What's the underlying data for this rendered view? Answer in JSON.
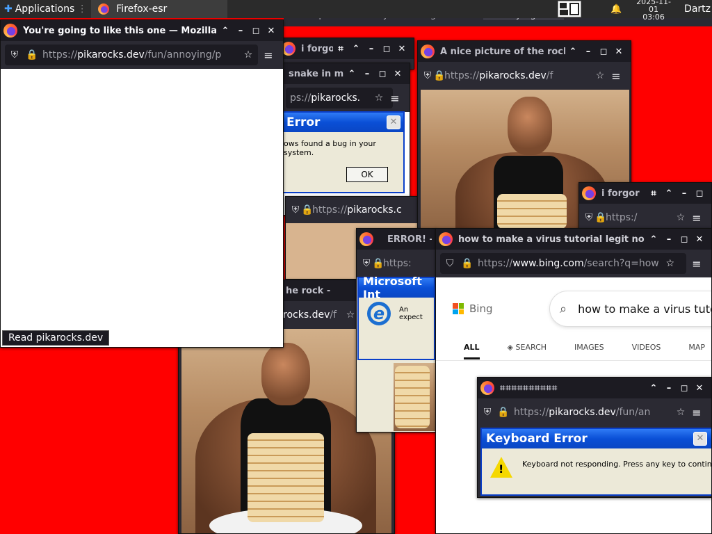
{
  "taskbar": {
    "apps_label": "Applications",
    "task_label": "Firefox-esr",
    "clock_date": "2025-11-01",
    "clock_time": "03:06",
    "user": "Dartz"
  },
  "behind_text": "Dispatcher: library is missing.",
  "behind_button": "Try Again",
  "windows": {
    "main": {
      "title": "You're going to like this one — Mozilla Fir",
      "url_prefix": "https://",
      "url_host": "pikarocks.dev",
      "url_path": "/fun/annoying/p",
      "status": "Read pikarocks.dev"
    },
    "forgor1": {
      "title": "i forgor"
    },
    "snake": {
      "title": "snake in m",
      "url_prefix": "ps://",
      "url_host": "pikarocks."
    },
    "rock_top": {
      "title": "A nice picture of the rock -",
      "url_prefix": "https://",
      "url_host": "pikarocks.dev",
      "url_path": "/f"
    },
    "forgor2": {
      "title": "i forgor",
      "url_prefix": "https:/",
      "url_host": ""
    },
    "mid": {
      "url_prefix": "https://",
      "url_host": "pikarocks.c"
    },
    "rock_big": {
      "title": "he rock -",
      "url_host": "rocks.dev",
      "url_path": "/f"
    },
    "error": {
      "title": "ERROR! —",
      "url_prefix": "https:"
    },
    "bing": {
      "title": "how to make a virus tutorial legit no scar",
      "url_prefix": "https://",
      "url_host": "www.bing.com",
      "url_path": "/search?q=how",
      "logo": "Bing",
      "query": "how to make a virus tutori",
      "tabs": [
        "ALL",
        "SEARCH",
        "IMAGES",
        "VIDEOS",
        "MAP"
      ]
    },
    "keyboard": {
      "url_prefix": "https://",
      "url_host": "pikarocks.dev",
      "url_path": "/fun/an"
    }
  },
  "dialogs": {
    "bug": {
      "title": "Error",
      "message": "ows found a bug in your system.",
      "ok": "OK"
    },
    "ie": {
      "title": "Microsoft Int",
      "message": "An expect"
    },
    "keyboard": {
      "title": "Keyboard Error",
      "message": "Keyboard not responding. Press any key to continue."
    }
  },
  "colors": {
    "desktop": "#ff0000",
    "xp_blue": "#0a4fd6",
    "firefox_chrome": "#2b2a33"
  }
}
